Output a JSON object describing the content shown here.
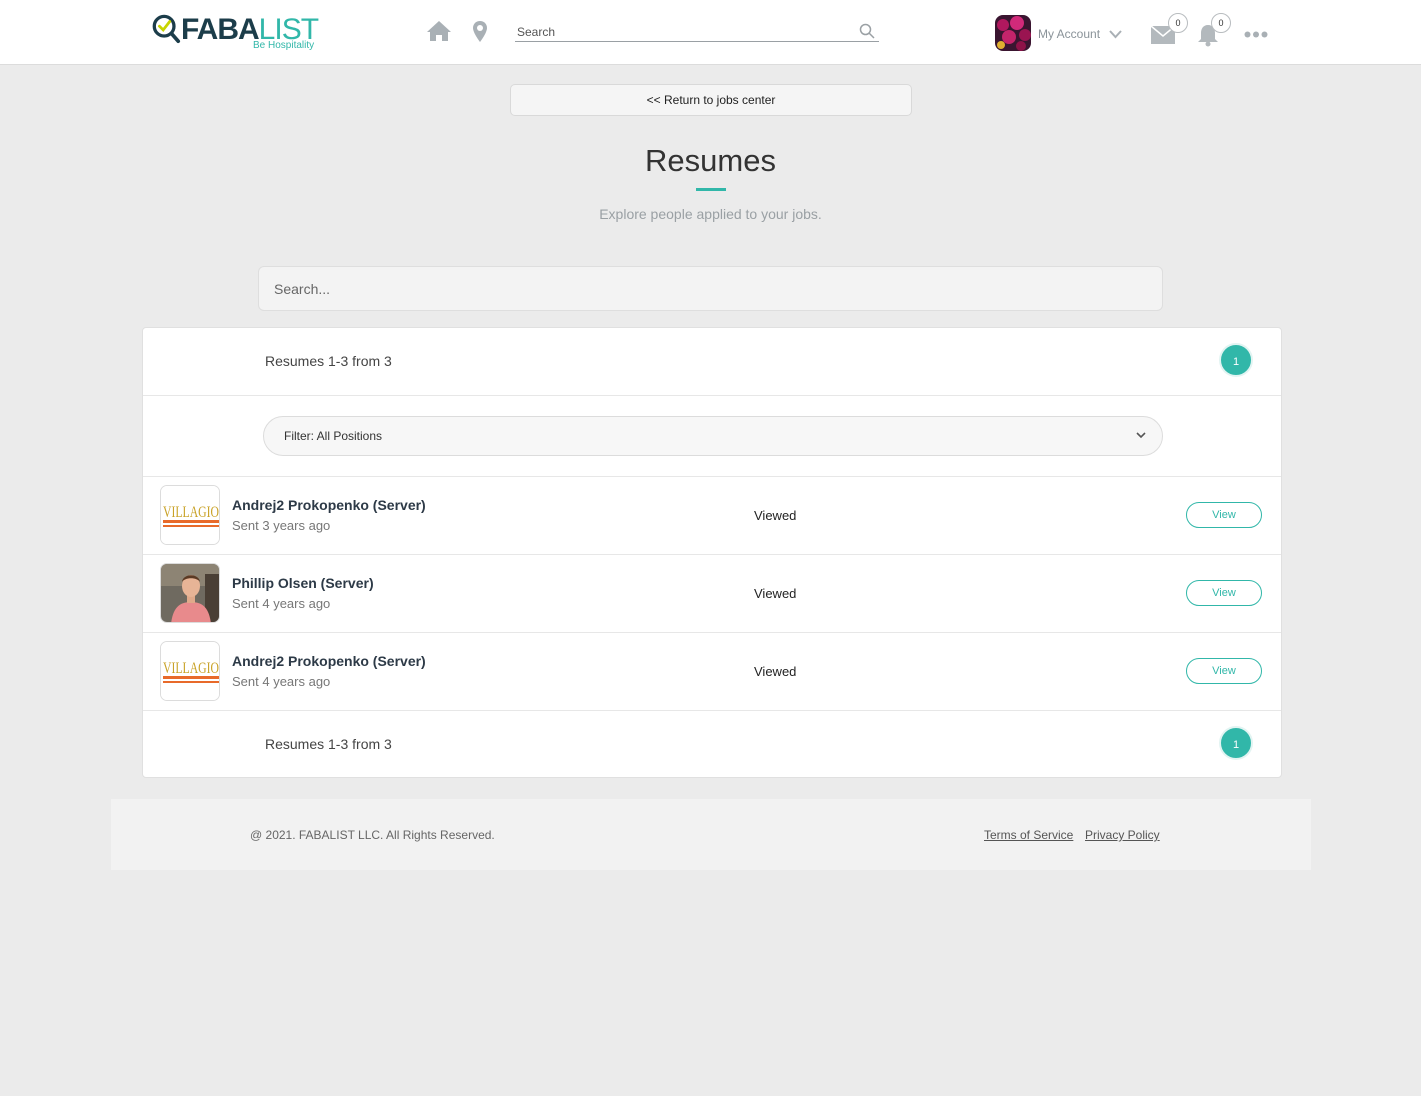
{
  "brand": {
    "name_part1": "FABA",
    "name_part2": "LIST",
    "tagline": "Be Hospitality"
  },
  "header": {
    "search_placeholder": "Search",
    "account_label": "My Account",
    "messages_count": "0",
    "notifications_count": "0"
  },
  "return_label": "<< Return to jobs center",
  "page": {
    "title": "Resumes",
    "subtitle": "Explore people applied to your jobs.",
    "search_placeholder": "Search..."
  },
  "results": {
    "count_text": "Resumes 1-3 from 3",
    "current_page": "1",
    "filter_label": "Filter: All Positions"
  },
  "resumes": [
    {
      "name": "Andrej2 Prokopenko (Server)",
      "sent": "Sent 3 years ago",
      "status": "Viewed",
      "action": "View",
      "thumb": "villagio-logo"
    },
    {
      "name": "Phillip Olsen (Server)",
      "sent": "Sent 4 years ago",
      "status": "Viewed",
      "action": "View",
      "thumb": "person-photo"
    },
    {
      "name": "Andrej2 Prokopenko (Server)",
      "sent": "Sent 4 years ago",
      "status": "Viewed",
      "action": "View",
      "thumb": "villagio-logo"
    }
  ],
  "footer": {
    "copyright": "@ 2021. FABALIST LLC. All Rights Reserved.",
    "terms": "Terms of Service",
    "privacy": "Privacy Policy"
  },
  "colors": {
    "accent": "#31b7a9",
    "dark": "#1c3d4a"
  }
}
